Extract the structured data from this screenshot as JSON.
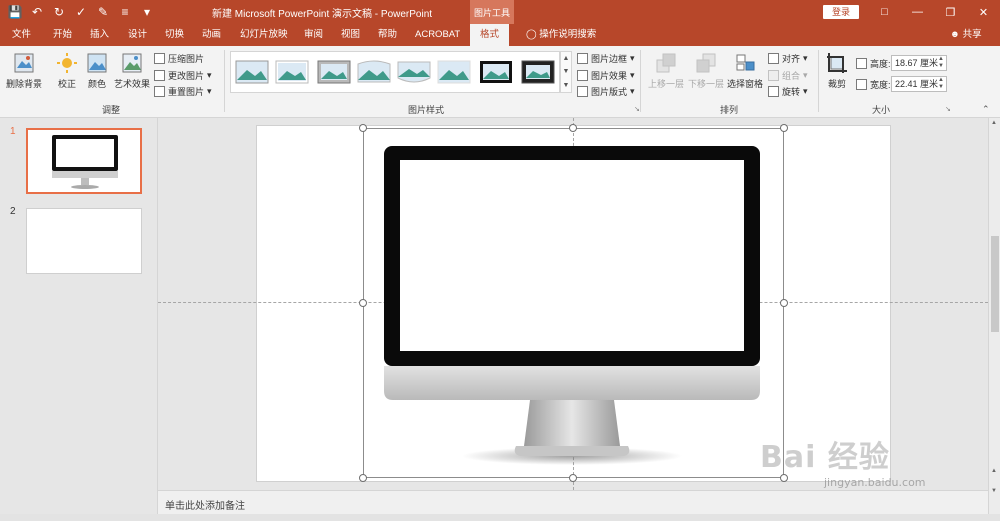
{
  "app": {
    "title": "新建 Microsoft PowerPoint 演示文稿 - PowerPoint",
    "context_tool_label": "图片工具",
    "login_label": "登录",
    "share_label": "共享",
    "tell_me": "操作说明搜索"
  },
  "tabs": [
    {
      "label": "文件"
    },
    {
      "label": "开始"
    },
    {
      "label": "插入"
    },
    {
      "label": "设计"
    },
    {
      "label": "切换"
    },
    {
      "label": "动画"
    },
    {
      "label": "幻灯片放映"
    },
    {
      "label": "审阅"
    },
    {
      "label": "视图"
    },
    {
      "label": "帮助"
    },
    {
      "label": "ACROBAT"
    },
    {
      "label": "格式",
      "active": true
    }
  ],
  "ribbon": {
    "adjust": {
      "remove_bg": "删除背景",
      "correct": "校正",
      "color": "颜色",
      "artistic": "艺术效果",
      "compress": "压缩图片",
      "change": "更改图片",
      "reset": "重置图片",
      "group_label": "调整"
    },
    "styles": {
      "border": "图片边框",
      "effects": "图片效果",
      "layout": "图片版式",
      "group_label": "图片样式"
    },
    "arrange": {
      "bring_forward": "上移一层",
      "send_backward": "下移一层",
      "selection_pane": "选择窗格",
      "align": "对齐",
      "group": "组合",
      "rotate": "旋转",
      "group_label": "排列"
    },
    "size": {
      "crop": "裁剪",
      "height_label": "高度:",
      "height_value": "18.67 厘米",
      "width_label": "宽度:",
      "width_value": "22.41 厘米",
      "group_label": "大小"
    }
  },
  "slides": [
    {
      "number": "1"
    },
    {
      "number": "2"
    }
  ],
  "notes_placeholder": "单击此处添加备注",
  "watermark": {
    "line1": "Bai 经验",
    "line2": "jingyan.baidu.com"
  },
  "colors": {
    "accent": "#b7472a",
    "selected_thumb_border": "#e86f47"
  }
}
